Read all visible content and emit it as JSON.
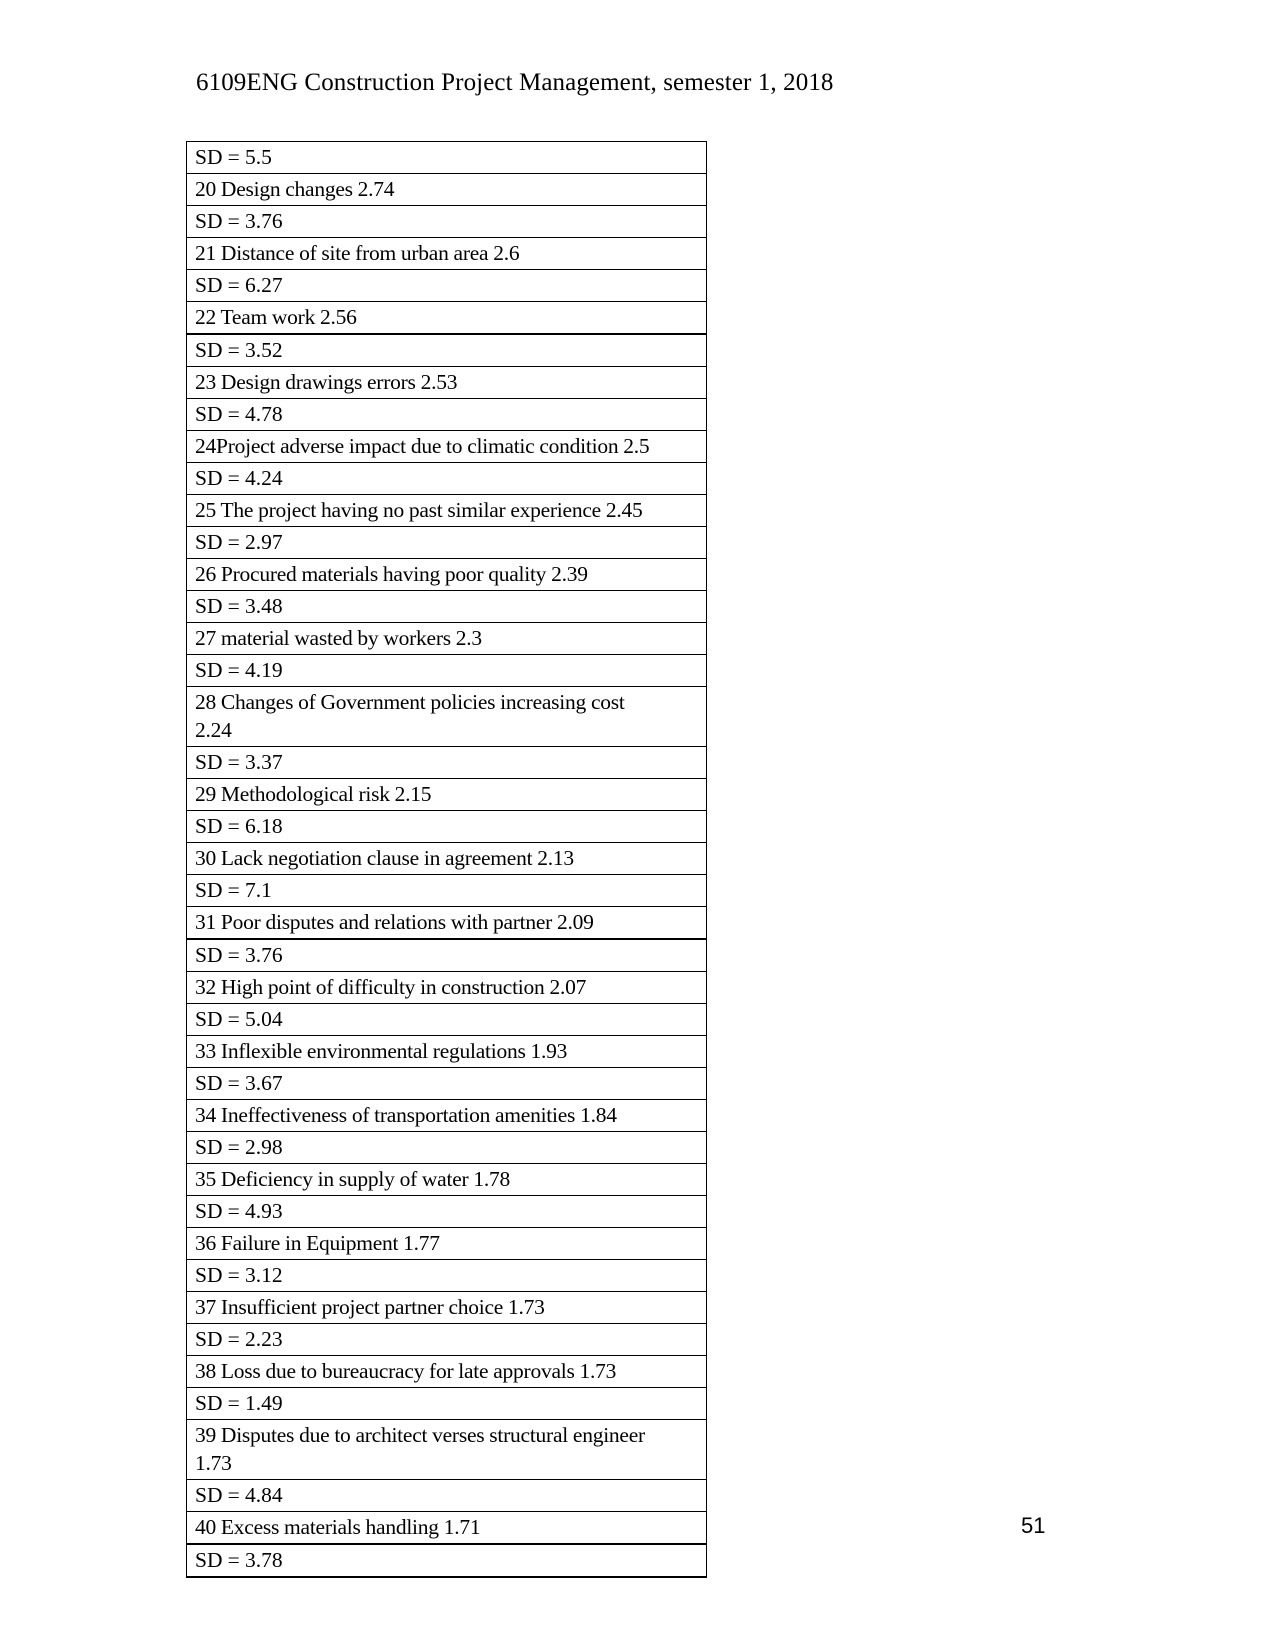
{
  "header": {
    "course_code_title": "6109ENG Construction Project Management, semester 1, 2018"
  },
  "page": {
    "number": "51"
  },
  "table": {
    "rows": [
      {
        "kind": "sd",
        "text": "SD = 5.5"
      },
      {
        "kind": "item",
        "text": "20 Design changes 2.74"
      },
      {
        "kind": "sd",
        "text": "SD = 3.76"
      },
      {
        "kind": "item",
        "text": "21 Distance of site from urban area 2.6"
      },
      {
        "kind": "sd",
        "text": "SD = 6.27"
      },
      {
        "kind": "item",
        "text": "22 Team work 2.56"
      },
      {
        "kind": "sd",
        "text": "SD = 3.52"
      },
      {
        "kind": "item",
        "text": "23 Design drawings errors  2.53"
      },
      {
        "kind": "sd",
        "text": "SD = 4.78"
      },
      {
        "kind": "item",
        "text": "24Project adverse   impact due to climatic condition 2.5"
      },
      {
        "kind": "sd",
        "text": "SD = 4.24"
      },
      {
        "kind": "item",
        "text": "25 The project having no past similar experience 2.45"
      },
      {
        "kind": "sd",
        "text": "SD = 2.97"
      },
      {
        "kind": "item",
        "text": "26 Procured materials having poor quality 2.39"
      },
      {
        "kind": "sd",
        "text": "SD = 3.48"
      },
      {
        "kind": "item",
        "text": "27 material wasted by workers 2.3"
      },
      {
        "kind": "sd",
        "text": "SD = 4.19"
      },
      {
        "kind": "item",
        "text": "28 Changes of Government policies increasing cost\n2.24"
      },
      {
        "kind": "sd",
        "text": "SD = 3.37"
      },
      {
        "kind": "item",
        "text": "29 Methodological risk 2.15"
      },
      {
        "kind": "sd",
        "text": "SD = 6.18"
      },
      {
        "kind": "item",
        "text": "30 Lack negotiation clause in agreement 2.13"
      },
      {
        "kind": "sd",
        "text": "SD = 7.1"
      },
      {
        "kind": "item",
        "text": "31 Poor disputes  and relations with partner 2.09"
      },
      {
        "kind": "sd",
        "text": "SD = 3.76"
      },
      {
        "kind": "item",
        "text": "32 High point of difficulty in construction 2.07"
      },
      {
        "kind": "sd",
        "text": "SD = 5.04"
      },
      {
        "kind": "item",
        "text": "33 Inflexible environmental regulations 1.93"
      },
      {
        "kind": "sd",
        "text": "SD = 3.67"
      },
      {
        "kind": "item",
        "text": "34 Ineffectiveness of transportation amenities 1.84"
      },
      {
        "kind": "sd",
        "text": "SD = 2.98"
      },
      {
        "kind": "item",
        "text": "35 Deficiency in supply of water 1.78"
      },
      {
        "kind": "sd",
        "text": "SD = 4.93"
      },
      {
        "kind": "item",
        "text": "36 Failure in Equipment  1.77"
      },
      {
        "kind": "sd",
        "text": "SD = 3.12"
      },
      {
        "kind": "item",
        "text": "37 Insufficient  project partner choice 1.73"
      },
      {
        "kind": "sd",
        "text": "SD = 2.23"
      },
      {
        "kind": "item",
        "text": "38 Loss due to bureaucracy for late approvals 1.73"
      },
      {
        "kind": "sd",
        "text": "SD = 1.49"
      },
      {
        "kind": "item",
        "text": "39 Disputes due to architect verses structural engineer\n1.73"
      },
      {
        "kind": "sd",
        "text": "SD = 4.84"
      },
      {
        "kind": "item",
        "text": "40 Excess materials handling 1.71"
      },
      {
        "kind": "sd",
        "text": "SD = 3.78"
      }
    ]
  }
}
